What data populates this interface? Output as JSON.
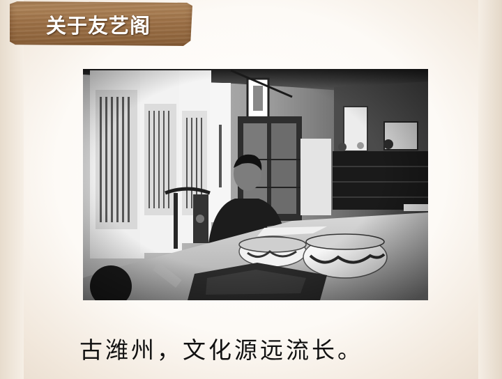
{
  "header": {
    "title": "关于友艺阁"
  },
  "photo": {
    "alt": "Calligrapher seated at a desk in a studio with hanging scrolls"
  },
  "caption": {
    "text": "古潍州，文化源远流长。"
  }
}
